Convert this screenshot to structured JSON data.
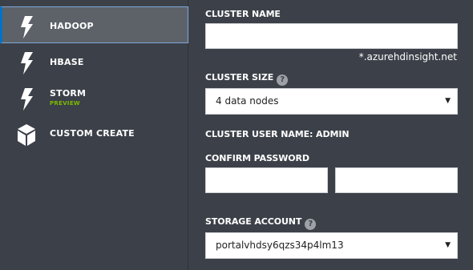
{
  "sidebar": {
    "items": [
      {
        "label": "HADOOP",
        "icon": "lightning-icon"
      },
      {
        "label": "HBASE",
        "icon": "lightning-icon"
      },
      {
        "label": "STORM",
        "sub": "PREVIEW",
        "icon": "lightning-icon"
      },
      {
        "label": "CUSTOM CREATE",
        "icon": "cube-icon"
      }
    ],
    "active_color": "#0072c6",
    "preview_color": "#7fba00"
  },
  "form": {
    "cluster_name": {
      "label": "CLUSTER NAME",
      "value": "",
      "suffix": "*.azurehdinsight.net"
    },
    "cluster_size": {
      "label": "CLUSTER SIZE",
      "help": "?",
      "value": "4 data nodes"
    },
    "user_name": {
      "label": "CLUSTER USER NAME: ADMIN"
    },
    "confirm_password": {
      "label": "CONFIRM PASSWORD",
      "value1": "",
      "value2": ""
    },
    "storage_account": {
      "label": "STORAGE ACCOUNT",
      "help": "?",
      "value": "portalvhdsy6qzs34p4lm13"
    }
  }
}
